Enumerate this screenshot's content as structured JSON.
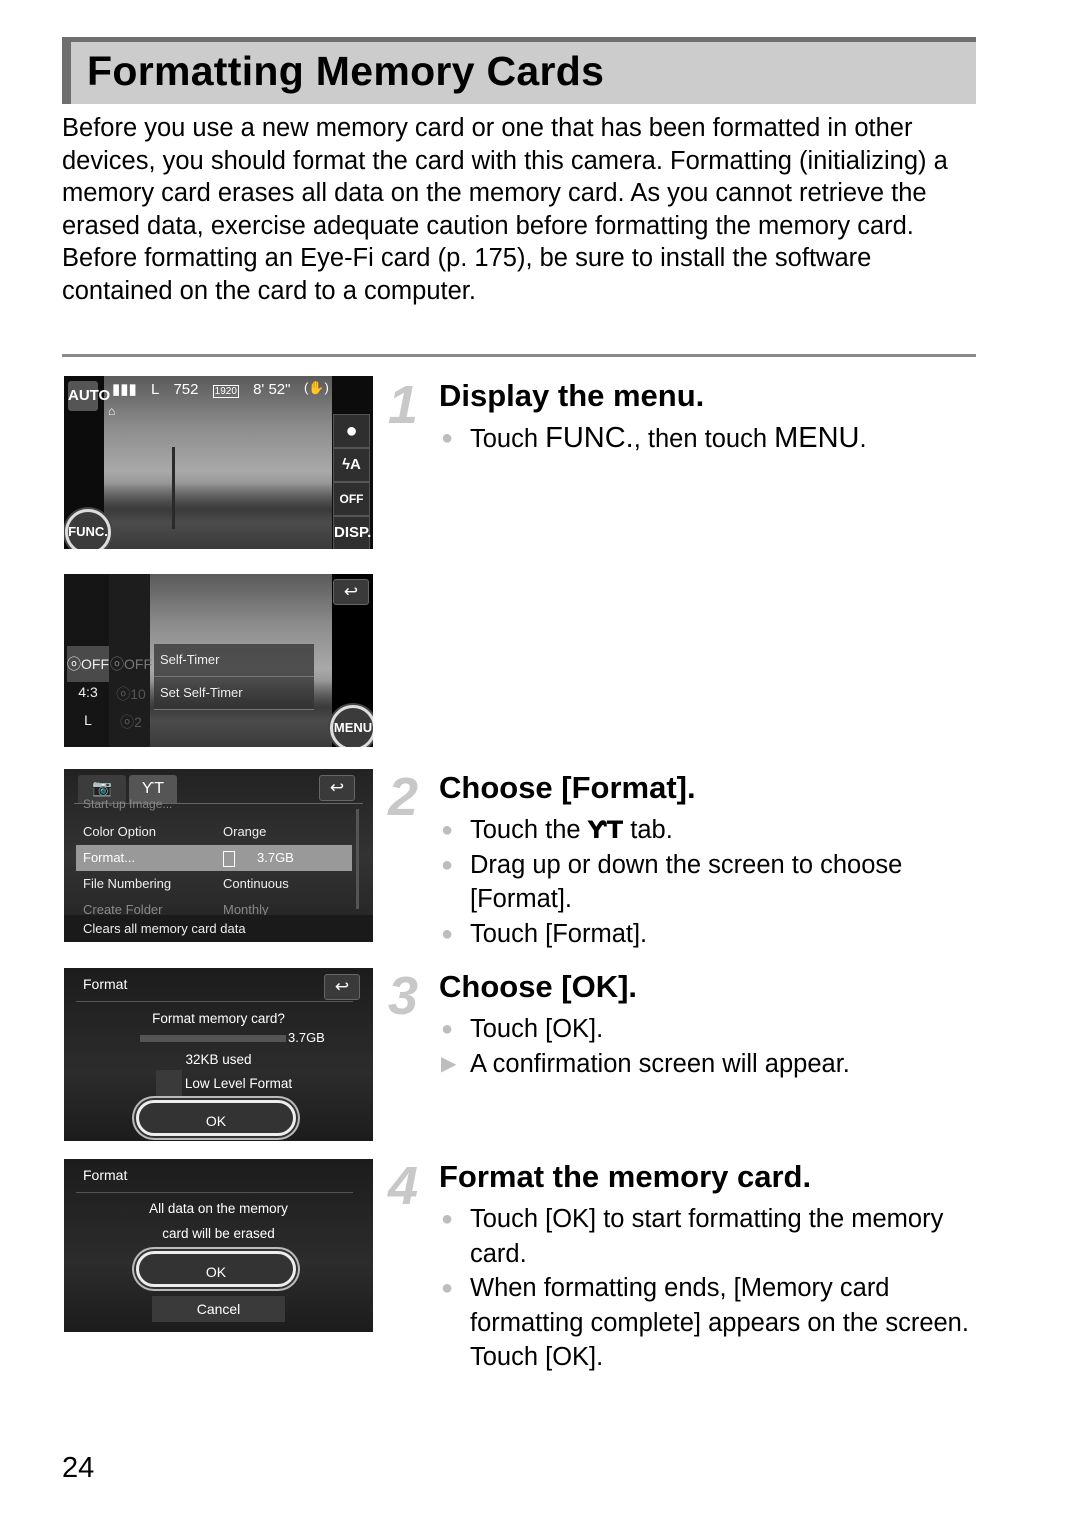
{
  "page": {
    "title": "Formatting Memory Cards",
    "intro_paragraphs": [
      "Before you use a new memory card or one that has been formatted in other devices, you should format the card with this camera. Formatting (initializing) a memory card erases all data on the memory card. As you cannot retrieve the erased data, exercise adequate caution before formatting the memory card.",
      "Before formatting an Eye-Fi card (p. 175), be sure to install the software contained on the card to a computer."
    ],
    "page_number": "24"
  },
  "screens": {
    "shooting": {
      "mode_badge": "AUTO",
      "battery": "▮▮▮",
      "image_size": "L",
      "shots_remaining": "752",
      "movie_res": "1920",
      "movie_time": "8' 52\"",
      "stabilizer_icon": "(✋)",
      "side_buttons": [
        "●",
        "ϟA",
        "OFF",
        "DISP."
      ],
      "func_button": "FUNC."
    },
    "func_menu": {
      "col1_items": [
        "ⓞOFF",
        "4:3",
        "L"
      ],
      "col2_items": [
        "ⓞOFF",
        "ⓞ10",
        "ⓞ2"
      ],
      "panel_items": [
        "Self-Timer",
        "Set Self-Timer"
      ],
      "menu_button": "MENU",
      "back_glyph": "↩"
    },
    "setup_menu": {
      "tab_camera": "📷",
      "tab_setup": "ƳT",
      "back_glyph": "↩",
      "rows": [
        {
          "label": "Start-up Image...",
          "value": ""
        },
        {
          "label": "Color Option",
          "value": "Orange"
        },
        {
          "label": "Format...",
          "value": "3.7GB"
        },
        {
          "label": "File Numbering",
          "value": "Continuous"
        },
        {
          "label": "Create Folder",
          "value": "Monthly"
        }
      ],
      "footer": "Clears all memory card data"
    },
    "format_dialog": {
      "title": "Format",
      "question": "Format memory card?",
      "capacity": "3.7GB",
      "used": "32KB used",
      "used_fraction": 0.0,
      "low_level_label": "Low Level Format",
      "low_level_checked": false,
      "ok": "OK",
      "back_glyph": "↩"
    },
    "confirm_dialog": {
      "title": "Format",
      "message_line1": "All data on the memory",
      "message_line2": "card will be erased",
      "ok": "OK",
      "cancel": "Cancel"
    }
  },
  "steps": [
    {
      "number": "1",
      "title": "Display the menu.",
      "bullets": [
        {
          "type": "dot",
          "pre": "Touch ",
          "icon1": "FUNC.",
          "mid": ", then touch ",
          "icon2": "MENU",
          "post": "."
        }
      ]
    },
    {
      "number": "2",
      "title": "Choose [Format].",
      "bullets": [
        {
          "type": "dot",
          "pre": "Touch the ",
          "icon": "ƳT",
          "post": " tab."
        },
        {
          "type": "dot",
          "text": "Drag up or down the screen to choose [Format]."
        },
        {
          "type": "dot",
          "text": "Touch [Format]."
        }
      ]
    },
    {
      "number": "3",
      "title": "Choose [OK].",
      "bullets": [
        {
          "type": "dot",
          "text": "Touch [OK]."
        },
        {
          "type": "arrow",
          "text": "A confirmation screen will appear."
        }
      ]
    },
    {
      "number": "4",
      "title": "Format the memory card.",
      "bullets": [
        {
          "type": "dot",
          "text": "Touch [OK] to start formatting the memory card."
        },
        {
          "type": "dot",
          "text": "When formatting ends, [Memory card formatting complete] appears on the screen. Touch [OK]."
        }
      ]
    }
  ]
}
